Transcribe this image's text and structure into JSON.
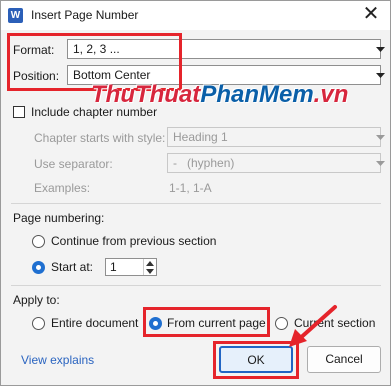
{
  "window": {
    "title": "Insert Page Number",
    "app_icon_letter": "W",
    "close_glyph": "✕"
  },
  "format": {
    "label": "Format:",
    "value": "1, 2, 3 ..."
  },
  "position": {
    "label": "Position:",
    "value": "Bottom Center"
  },
  "watermark": {
    "part1": "ThuThuat",
    "part2": "PhanMem",
    "part3": ".vn"
  },
  "chapter": {
    "include_label": "Include chapter number",
    "include_checked": false,
    "starts_label": "Chapter starts with style:",
    "starts_value": "Heading 1",
    "separator_label": "Use separator:",
    "separator_value": "-   (hyphen)",
    "examples_label": "Examples:",
    "examples_value": "1-1, 1-A"
  },
  "page_numbering": {
    "label": "Page numbering:",
    "continue_label": "Continue from previous section",
    "start_at_label": "Start at:",
    "start_at_value": "1",
    "selected": "start_at"
  },
  "apply_to": {
    "label": "Apply to:",
    "options": [
      "Entire document",
      "From current page",
      "Current section"
    ],
    "selected": "From current page"
  },
  "footer": {
    "link": "View explains",
    "ok": "OK",
    "cancel": "Cancel"
  },
  "colors": {
    "accent": "#1f6fd0",
    "highlight_red": "#e5242b",
    "link": "#2a64c0"
  }
}
